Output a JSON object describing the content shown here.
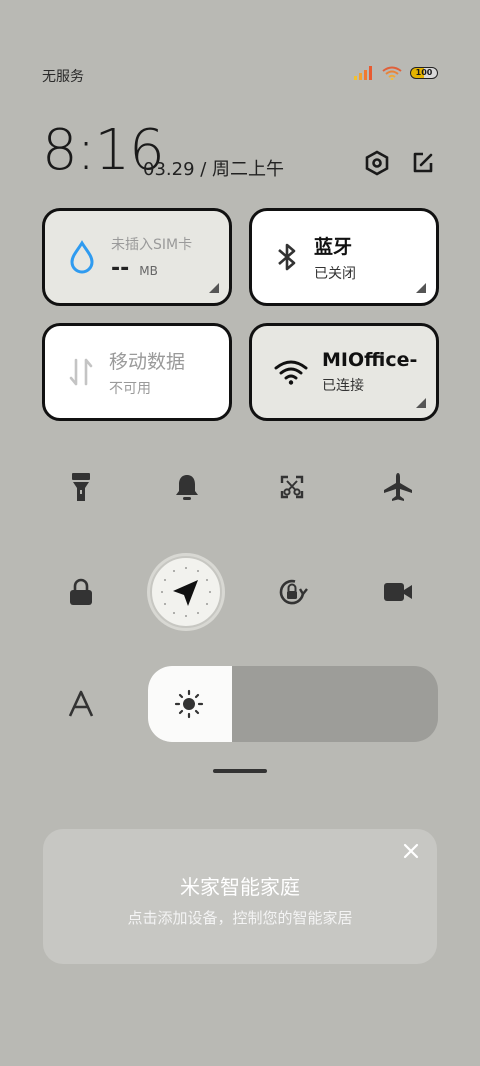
{
  "status_bar": {
    "carrier": "无服务",
    "battery": "100"
  },
  "header": {
    "time": "8:16",
    "date": "03.29 / 周二上午"
  },
  "tiles": {
    "data_usage": {
      "label": "未插入SIM卡",
      "value": "--",
      "unit": "MB"
    },
    "bluetooth": {
      "title": "蓝牙",
      "status": "已关闭"
    },
    "mobile_data": {
      "title": "移动数据",
      "status": "不可用"
    },
    "wifi": {
      "title": "MIOffice-",
      "status": "已连接"
    }
  },
  "toggles": [
    "flashlight-icon",
    "bell-icon",
    "screenshot-icon",
    "airplane-icon",
    "lock-icon",
    "location-icon",
    "rotation-lock-icon",
    "video-icon"
  ],
  "brightness": {
    "level": 0.29
  },
  "card": {
    "title": "米家智能家庭",
    "subtitle": "点击添加设备，控制您的智能家居"
  },
  "colors": {
    "background": "#b9b9b4",
    "water_icon": "#2f9bf0"
  }
}
